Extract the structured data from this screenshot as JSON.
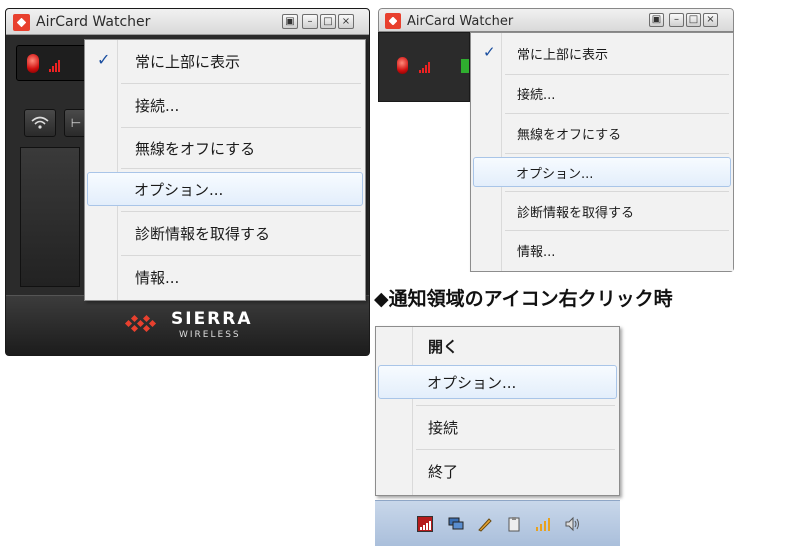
{
  "window": {
    "title": "AirCard Watcher",
    "buttons": {
      "mini": "▣",
      "minimize": "–",
      "maximize": "□",
      "close": "×"
    },
    "logo_main": "SIERRA",
    "logo_sub": "WIRELESS"
  },
  "window_menu": {
    "items": [
      {
        "label": "常に上部に表示",
        "checked": true
      },
      {
        "label": "接続..."
      },
      {
        "label": "無線をオフにする"
      },
      {
        "label": "オプション...",
        "highlighted": true
      },
      {
        "label": "診断情報を取得する"
      },
      {
        "label": "情報..."
      }
    ],
    "check_glyph": "✓"
  },
  "caption": "◆通知領域のアイコン右クリック時",
  "tray_menu": {
    "items": [
      {
        "label": "開く",
        "bold": true
      },
      {
        "label": "オプション...",
        "highlighted": true
      },
      {
        "label": "接続"
      },
      {
        "label": "終了"
      }
    ]
  },
  "tray_icons": [
    "aircard-signal-icon",
    "network-icon",
    "pen-icon",
    "clipboard-icon",
    "wifi-signal-icon",
    "volume-icon"
  ],
  "colors": {
    "brand_red": "#e8402e",
    "menu_highlight": "#e3eefb",
    "taskbar": "#aabfdb"
  }
}
